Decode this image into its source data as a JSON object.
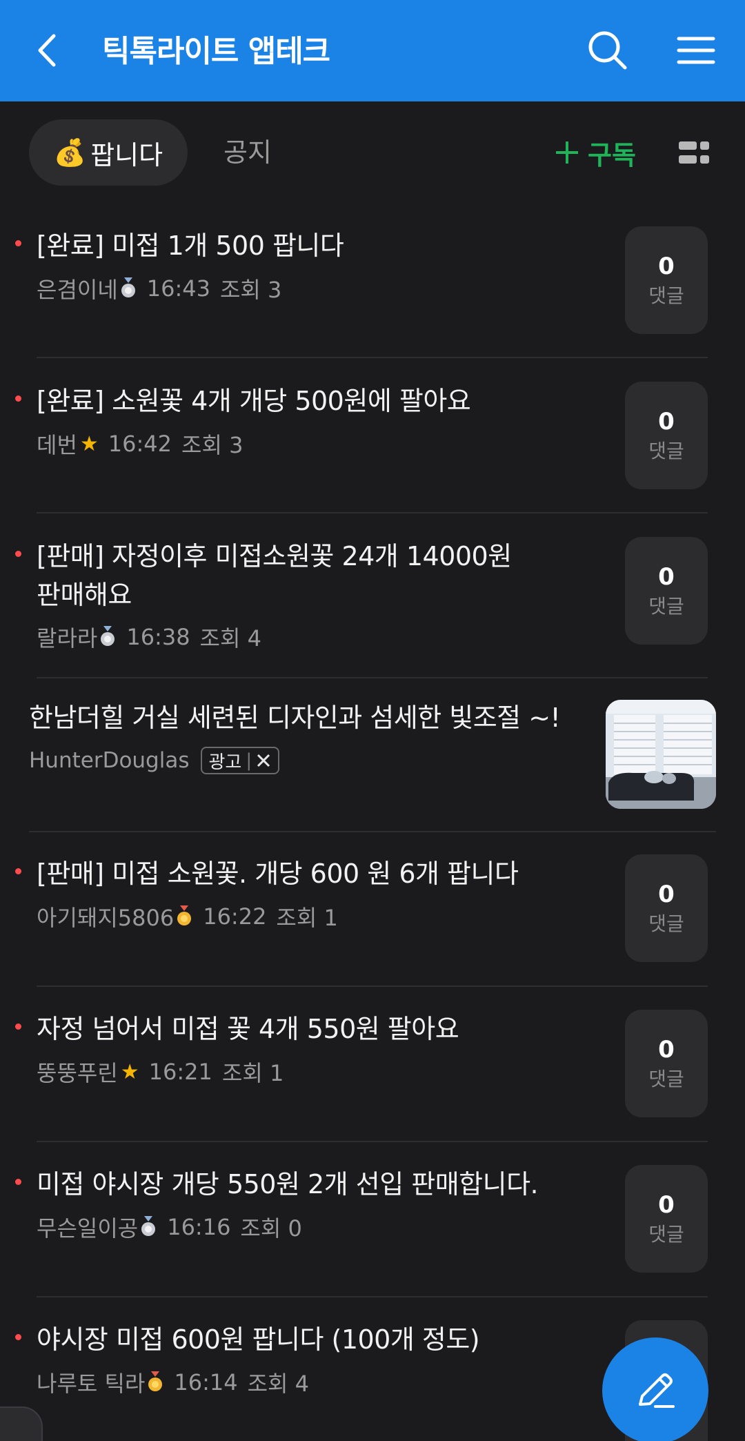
{
  "header": {
    "title": "틱톡라이트 앱테크"
  },
  "tabs": {
    "active_label": "팝니다",
    "active_emoji": "💰",
    "notice_label": "공지",
    "subscribe_label": "구독"
  },
  "colors": {
    "header_bg": "#1c83e6",
    "subscribe": "#1fb35a",
    "unread_dot": "#ff4b4b",
    "background": "#1b1b1d"
  },
  "posts": [
    {
      "title": "[완료] 미접 1개 500 팝니다",
      "author": "은겸이네",
      "badge": "silver-medal",
      "time": "16:43",
      "views": "조회 3",
      "comments": "0",
      "comment_label": "댓글"
    },
    {
      "title": "[완료] 소원꽃 4개 개당 500원에 팔아요",
      "author": "데번",
      "badge": "star",
      "time": "16:42",
      "views": "조회 3",
      "comments": "0",
      "comment_label": "댓글"
    },
    {
      "title_line1": "[판매] 자정이후 미접소원꽃 24개 14000원",
      "title_line2": "판매해요",
      "author": "랄라라",
      "badge": "silver-medal",
      "time": "16:38",
      "views": "조회 4",
      "comments": "0",
      "comment_label": "댓글"
    },
    {
      "title": "[판매] 미접 소원꽃. 개당 600 원 6개 팝니다",
      "author": "아기돼지5806",
      "badge": "gold-medal",
      "time": "16:22",
      "views": "조회 1",
      "comments": "0",
      "comment_label": "댓글"
    },
    {
      "title": "자정 넘어서 미접 꽃 4개 550원 팔아요",
      "author": "뚱뚱푸린",
      "badge": "star",
      "time": "16:21",
      "views": "조회 1",
      "comments": "0",
      "comment_label": "댓글"
    },
    {
      "title": "미접 야시장 개당 550원 2개 선입 판매합니다.",
      "author": "무슨일이공",
      "badge": "silver-medal",
      "time": "16:16",
      "views": "조회 0",
      "comments": "0",
      "comment_label": "댓글"
    },
    {
      "title": "야시장 미접 600원 팝니다 (100개 정도)",
      "author": "나루토 틱라",
      "badge": "gold-medal",
      "time": "16:14",
      "views": "조회 4"
    }
  ],
  "ad": {
    "title": "한남더힐 거실 세련된 디자인과 섬세한 빛조절 ~!",
    "advertiser": "HunterDouglas",
    "badge_label": "광고",
    "close_icon": "close-icon"
  },
  "fab": {
    "icon": "pencil-icon"
  }
}
